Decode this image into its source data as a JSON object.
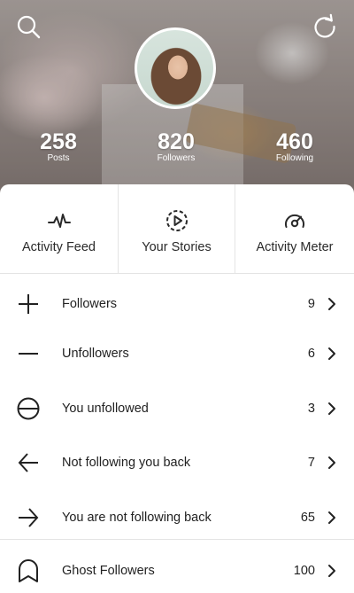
{
  "stats": {
    "posts": {
      "value": "258",
      "label": "Posts"
    },
    "followers": {
      "value": "820",
      "label": "Followers"
    },
    "following": {
      "value": "460",
      "label": "Following"
    }
  },
  "tiles": {
    "activity_feed": {
      "label": "Activity Feed",
      "icon": "pulse-icon"
    },
    "your_stories": {
      "label": "Your Stories",
      "icon": "play-circle-icon"
    },
    "activity_meter": {
      "label": "Activity Meter",
      "icon": "gauge-icon"
    }
  },
  "rows": [
    {
      "label": "Followers",
      "count": "9",
      "icon": "plus-icon"
    },
    {
      "label": "Unfollowers",
      "count": "6",
      "icon": "minus-icon"
    },
    {
      "label": "You unfollowed",
      "count": "3",
      "icon": "circle-minus-icon"
    },
    {
      "label": "Not following you back",
      "count": "7",
      "icon": "arrow-left-icon"
    },
    {
      "label": "You are not following back",
      "count": "65",
      "icon": "arrow-right-icon"
    },
    {
      "label": "Ghost Followers",
      "count": "100",
      "icon": "ghost-icon"
    }
  ],
  "colors": {
    "text": "#222222",
    "divider": "#e4e4e4",
    "background": "#ffffff"
  }
}
